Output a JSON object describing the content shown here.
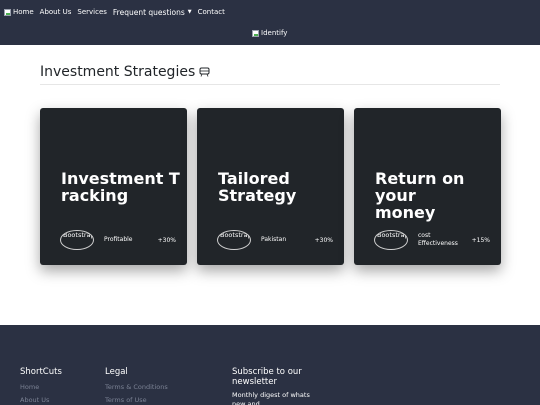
{
  "nav": {
    "home": "Home",
    "about": "About Us",
    "services": "Services",
    "faq": "Frequent questions",
    "contact": "Contact",
    "brand": "Identify"
  },
  "section": {
    "title": "Investment Strategies",
    "icon": "train-icon"
  },
  "cards": [
    {
      "title": "Investment Tracking",
      "avatar_alt": "Bootstrap",
      "label": "Profitable",
      "value": "+30%"
    },
    {
      "title": "Tailored Strategy",
      "avatar_alt": "Bootstrap",
      "label": "Pakistan",
      "value": "+30%"
    },
    {
      "title": "Return on your money",
      "avatar_alt": "Bootstrap",
      "label": "cost Effectiveness",
      "value": "+15%"
    }
  ],
  "footer": {
    "shortcuts": {
      "heading": "ShortCuts",
      "links": [
        "Home",
        "About Us"
      ]
    },
    "legal": {
      "heading": "Legal",
      "links": [
        "Terms & Conditions",
        "Terms of Use"
      ]
    },
    "subscribe": {
      "heading": "Subscribe to our newsletter",
      "text": "Monthly digest of whats new and"
    }
  },
  "colors": {
    "navbar": "#2b3143",
    "card": "#212529",
    "footer": "#2b3143"
  }
}
